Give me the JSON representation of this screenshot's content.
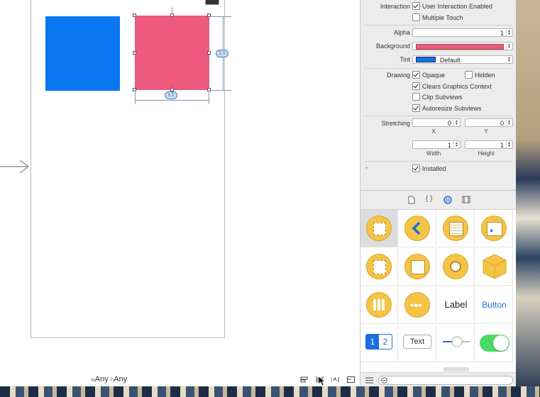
{
  "size_class": {
    "w_prefix": "w",
    "w_value": "Any",
    "h_prefix": "h",
    "h_value": "Any"
  },
  "constraints": {
    "height_badge": "1:1",
    "width_badge": "1:1"
  },
  "colors": {
    "blue_view": "#0a76f0",
    "pink_view": "#ed5a7d",
    "tint": "#0a76f0",
    "background": "#ed5a7d"
  },
  "inspector": {
    "interaction_label": "Interaction",
    "user_interaction": "User Interaction Enabled",
    "multiple_touch": "Multiple Touch",
    "alpha_label": "Alpha",
    "alpha_value": "1",
    "background_label": "Background",
    "tint_label": "Tint",
    "tint_value": "Default",
    "drawing_label": "Drawing",
    "opaque": "Opaque",
    "hidden": "Hidden",
    "clears_graphics": "Clears Graphics Context",
    "clip_subviews": "Clip Subviews",
    "autoresize": "Autoresize Subviews",
    "stretching_label": "Stretching",
    "stretch_x": "0",
    "stretch_y": "0",
    "stretch_w": "1",
    "stretch_h": "1",
    "x_label": "X",
    "y_label": "Y",
    "width_label": "Width",
    "height_label": "Height",
    "installed": "Installed",
    "plus": "+"
  },
  "library": {
    "tabs": [
      "file-icon",
      "braces-icon",
      "object-icon",
      "media-icon"
    ],
    "braces_text": "{ }",
    "label_item": "Label",
    "button_item": "Button",
    "seg1": "1",
    "seg2": "2",
    "textfield_item": "Text"
  }
}
